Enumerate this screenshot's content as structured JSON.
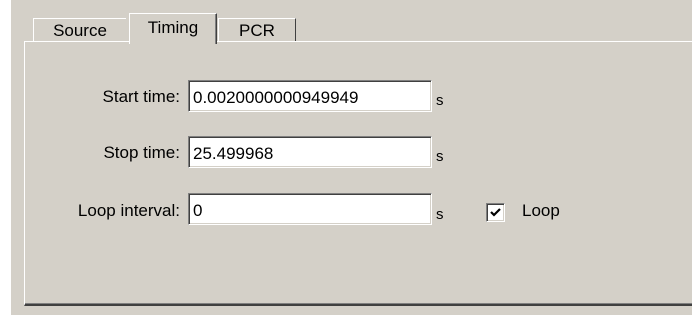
{
  "tabs": [
    {
      "label": "Source",
      "active": false
    },
    {
      "label": "Timing",
      "active": true
    },
    {
      "label": "PCR",
      "active": false
    }
  ],
  "timing": {
    "start_label": "Start time:",
    "start_value": "0.0020000000949949",
    "start_unit": "s",
    "stop_label": "Stop time:",
    "stop_value": "25.499968",
    "stop_unit": "s",
    "loop_interval_label": "Loop interval:",
    "loop_interval_value": "0",
    "loop_interval_unit": "s",
    "loop_label": "Loop",
    "loop_checked": true
  },
  "colors": {
    "face": "#d4d0c8",
    "highlight": "#ffffff",
    "shadow": "#808080",
    "dark_shadow": "#404040"
  }
}
